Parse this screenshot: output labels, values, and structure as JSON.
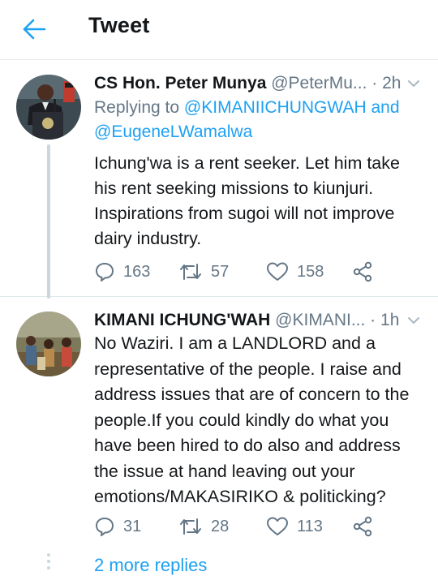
{
  "header": {
    "title": "Tweet",
    "back_icon": "arrow-left-icon",
    "accent": "#1da1f2"
  },
  "tweets": [
    {
      "author_name": "CS Hon. Peter Munya",
      "handle": "@PeterMu...",
      "separator": "·",
      "time": "2h",
      "replying_prefix": "Replying to",
      "replying_to": [
        "@KIMANIICHUNGWAH",
        "@EugeneLWamalwa"
      ],
      "replying_joiner": "and",
      "text": "Ichung'wa is a rent seeker. Let him take his rent seeking missions to kiunjuri. Inspirations from sugoi will not improve dairy industry.",
      "replies": "163",
      "retweets": "57",
      "likes": "158"
    },
    {
      "author_name": "KIMANI ICHUNG'WAH",
      "handle": "@KIMANI...",
      "separator": "·",
      "time": "1h",
      "text": "No Waziri. I am a LANDLORD and a representative of the people. I raise and address issues that are of concern to the people.If you could kindly do what you have been hired to do also and address the issue at hand leaving out your emotions/MAKASIRIKO & politicking?",
      "replies": "31",
      "retweets": "28",
      "likes": "113"
    }
  ],
  "more_replies": "2 more replies",
  "colors": {
    "text": "#14171a",
    "secondary": "#657786",
    "link": "#1da1f2",
    "divider": "#e1e8ed",
    "thread_line": "#ccd6dd"
  }
}
